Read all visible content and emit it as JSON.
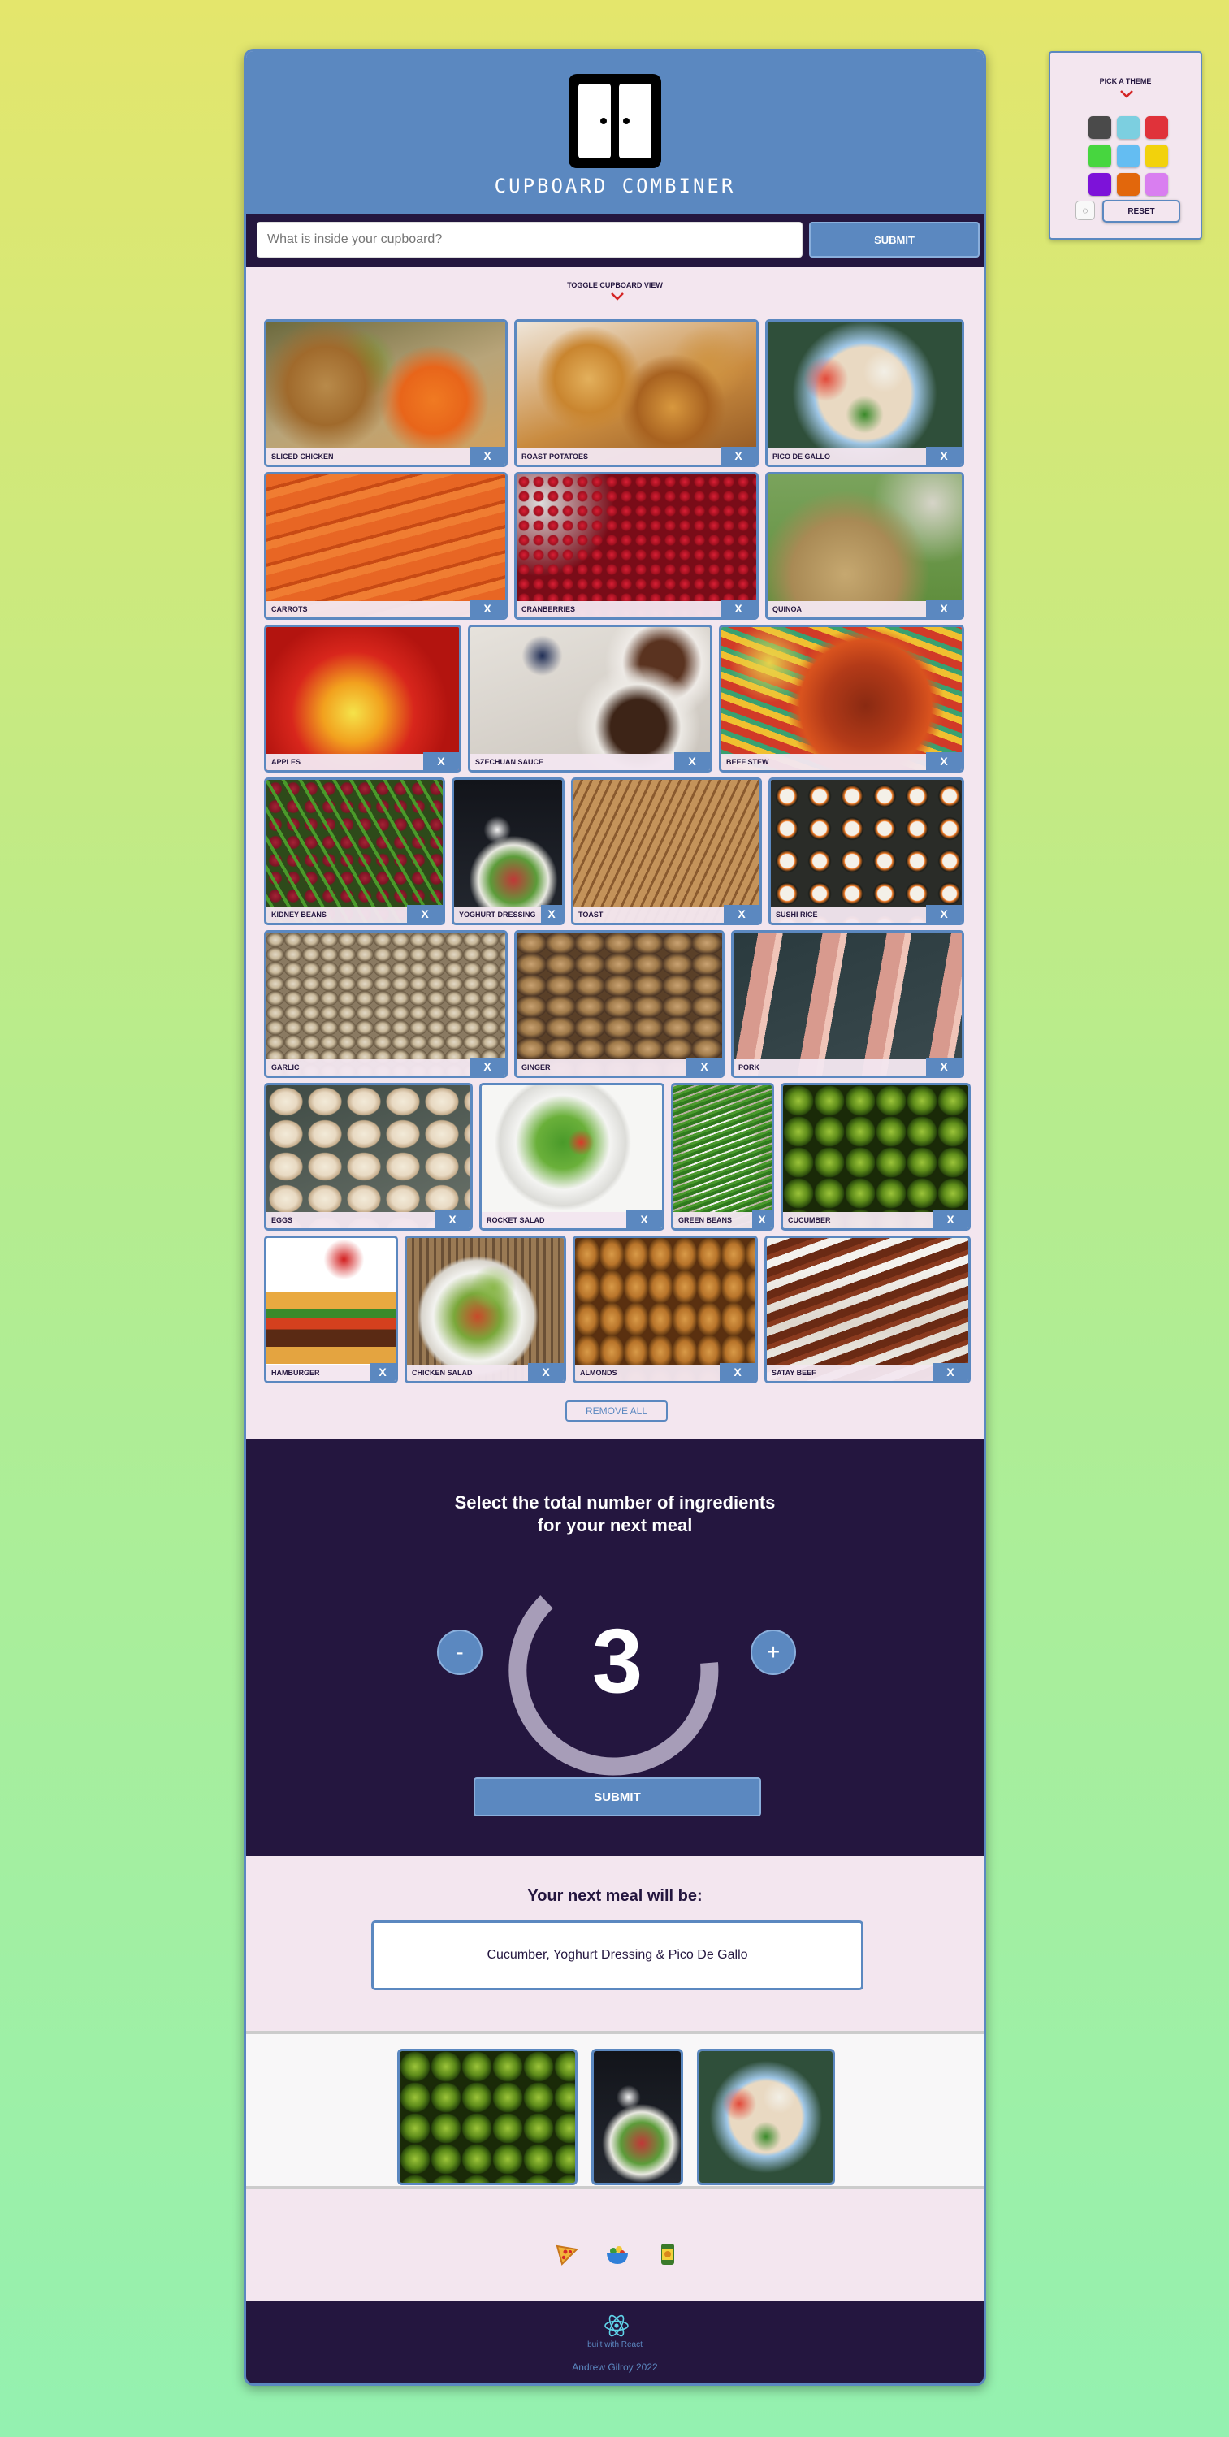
{
  "theme": {
    "title": "PICK A THEME",
    "swatches": [
      "#4a4a4a",
      "#7ccfe0",
      "#e0323a",
      "#47d63f",
      "#64bdf2",
      "#f2d20c",
      "#7d12d9",
      "#e2670c",
      "#d97ef0"
    ],
    "reset_label": "RESET"
  },
  "header": {
    "brand": "CUPBOARD COMBINER"
  },
  "search": {
    "placeholder": "What is inside your cupboard?",
    "submit_label": "SUBMIT"
  },
  "toggle": {
    "label": "TOGGLE CUPBOARD VIEW"
  },
  "cupboard": {
    "rows": [
      [
        {
          "label": "SLICED CHICKEN",
          "photo": "chicken"
        },
        {
          "label": "ROAST POTATOES",
          "photo": "potatoes"
        },
        {
          "label": "PICO DE GALLO",
          "photo": "pico"
        }
      ],
      [
        {
          "label": "CARROTS",
          "photo": "carrots"
        },
        {
          "label": "CRANBERRIES",
          "photo": "cranberries"
        },
        {
          "label": "QUINOA",
          "photo": "quinoa"
        }
      ],
      [
        {
          "label": "APPLES",
          "photo": "apples"
        },
        {
          "label": "SZECHUAN SAUCE",
          "photo": "szechuan"
        },
        {
          "label": "BEEF STEW",
          "photo": "stew"
        }
      ],
      [
        {
          "label": "KIDNEY BEANS",
          "photo": "kidney"
        },
        {
          "label": "YOGHURT DRESSING",
          "photo": "yoghurt"
        },
        {
          "label": "TOAST",
          "photo": "toast"
        },
        {
          "label": "SUSHI RICE",
          "photo": "sushi"
        }
      ],
      [
        {
          "label": "GARLIC",
          "photo": "garlic"
        },
        {
          "label": "GINGER",
          "photo": "ginger"
        },
        {
          "label": "PORK",
          "photo": "pork"
        }
      ],
      [
        {
          "label": "EGGS",
          "photo": "eggs"
        },
        {
          "label": "ROCKET SALAD",
          "photo": "rocket"
        },
        {
          "label": "GREEN BEANS",
          "photo": "greenbeans"
        },
        {
          "label": "CUCUMBER",
          "photo": "cucumber"
        }
      ],
      [
        {
          "label": "HAMBURGER",
          "photo": "burger"
        },
        {
          "label": "CHICKEN SALAD",
          "photo": "chickensalad"
        },
        {
          "label": "ALMONDS",
          "photo": "almonds"
        },
        {
          "label": "SATAY BEEF",
          "photo": "satay"
        }
      ]
    ],
    "remove_label": "X",
    "remove_all_label": "REMOVE ALL"
  },
  "selector": {
    "title_line1": "Select the total number of ingredients",
    "title_line2": "for your next meal",
    "count": "3",
    "minus_label": "-",
    "plus_label": "+",
    "submit_label": "SUBMIT"
  },
  "result": {
    "title": "Your next meal will be:",
    "meal": "Cucumber, Yoghurt Dressing & Pico De Gallo",
    "thumbs": [
      "cucumber",
      "yoghurt",
      "pico"
    ]
  },
  "footer": {
    "built_with": "built with React",
    "author": "Andrew Gilroy 2022"
  }
}
